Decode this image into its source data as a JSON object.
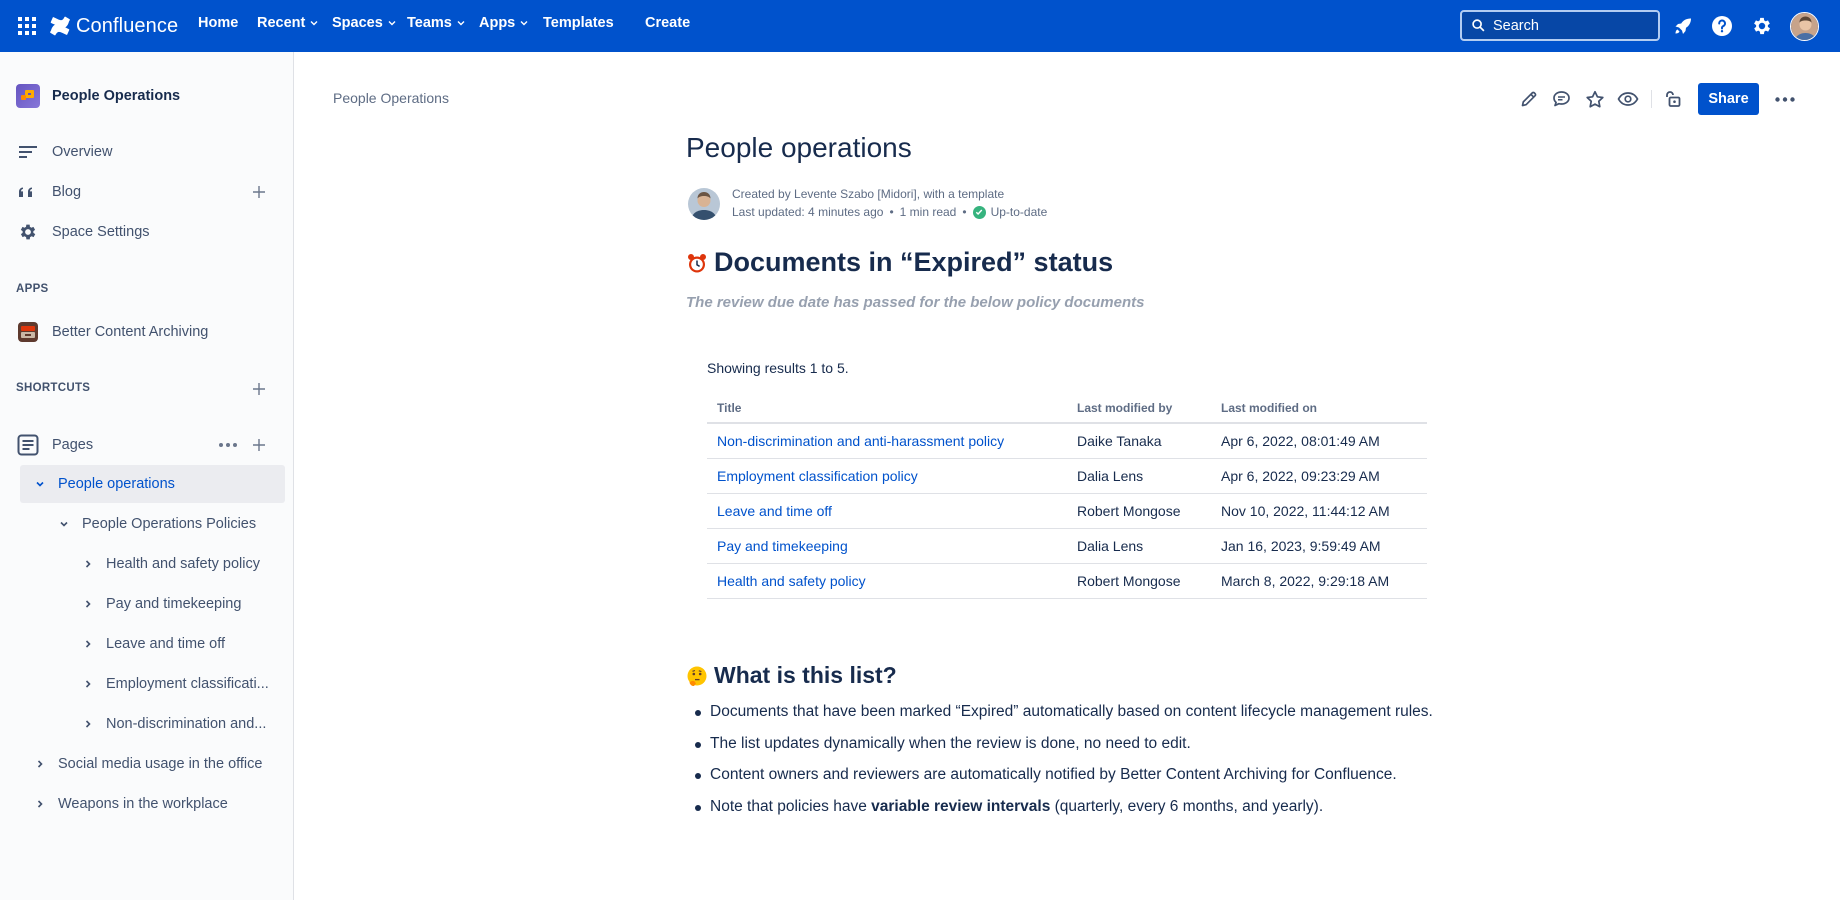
{
  "topnav": {
    "brand": "Confluence",
    "items": [
      {
        "label": "Home",
        "dropdown": false
      },
      {
        "label": "Recent",
        "dropdown": true
      },
      {
        "label": "Spaces",
        "dropdown": true
      },
      {
        "label": "Teams",
        "dropdown": true
      },
      {
        "label": "Apps",
        "dropdown": true
      },
      {
        "label": "Templates",
        "dropdown": false
      },
      {
        "label": "Create",
        "dropdown": false
      }
    ],
    "search_placeholder": "Search",
    "icons": [
      "notifications-rocket-icon",
      "help-icon",
      "settings-icon",
      "user-avatar"
    ]
  },
  "sidebar": {
    "space_name": "People Operations",
    "nav": [
      {
        "label": "Overview",
        "icon": "overview-icon"
      },
      {
        "label": "Blog",
        "icon": "quote-icon"
      },
      {
        "label": "Space Settings",
        "icon": "gear-icon"
      }
    ],
    "apps_heading": "APPS",
    "apps": [
      {
        "label": "Better Content Archiving",
        "icon": "archive-app-icon"
      }
    ],
    "shortcuts_heading": "SHORTCUTS",
    "pages_label": "Pages",
    "tree": [
      {
        "label": "People operations",
        "selected": true,
        "expanded": true
      },
      {
        "label": "People Operations Policies",
        "expanded": true
      },
      {
        "label": "Health and safety policy"
      },
      {
        "label": "Pay and timekeeping"
      },
      {
        "label": "Leave and time off"
      },
      {
        "label": "Employment classificati..."
      },
      {
        "label": "Non-discrimination and..."
      },
      {
        "label": "Social media usage in the office"
      },
      {
        "label": "Weapons in the workplace"
      }
    ]
  },
  "page": {
    "breadcrumb": "People Operations",
    "share_label": "Share",
    "title": "People operations",
    "created_by": "Created by Levente Szabo [Midori], with a template",
    "last_updated": "Last updated: 4 minutes ago",
    "read_time": "1 min read",
    "status": "Up-to-date",
    "section1_title": "Documents in “Expired” status",
    "section1_subtitle": "The review due date has passed for the below policy documents",
    "results_text": "Showing results 1 to 5.",
    "table": {
      "headers": [
        "Title",
        "Last modified by",
        "Last modified on"
      ],
      "rows": [
        [
          "Non-discrimination and anti-harassment policy",
          "Daike Tanaka",
          "Apr 6, 2022, 08:01:49 AM"
        ],
        [
          "Employment classification policy",
          "Dalia Lens",
          "Apr 6, 2022, 09:23:29 AM"
        ],
        [
          "Leave and time off",
          "Robert Mongose",
          "Nov 10, 2022, 11:44:12 AM"
        ],
        [
          "Pay and timekeeping",
          "Dalia Lens",
          "Jan 16, 2023, 9:59:49 AM"
        ],
        [
          "Health and safety policy",
          "Robert Mongose",
          "March 8, 2022, 9:29:18 AM"
        ]
      ]
    },
    "section2_title": "What is this list?",
    "bullets": [
      "Documents that have been marked “Expired” automatically based on content lifecycle management rules.",
      "The list updates dynamically when the review is done, no need to edit.",
      "Content owners and reviewers are automatically notified by Better Content Archiving for Confluence."
    ],
    "bullet4": {
      "before": "Note that policies have ",
      "bold": "variable review intervals",
      "after": " (quarterly, every 6 months, and yearly)."
    }
  },
  "colors": {
    "brand_blue": "#0052cc",
    "link": "#0052cc",
    "status_green": "#36b37e"
  }
}
